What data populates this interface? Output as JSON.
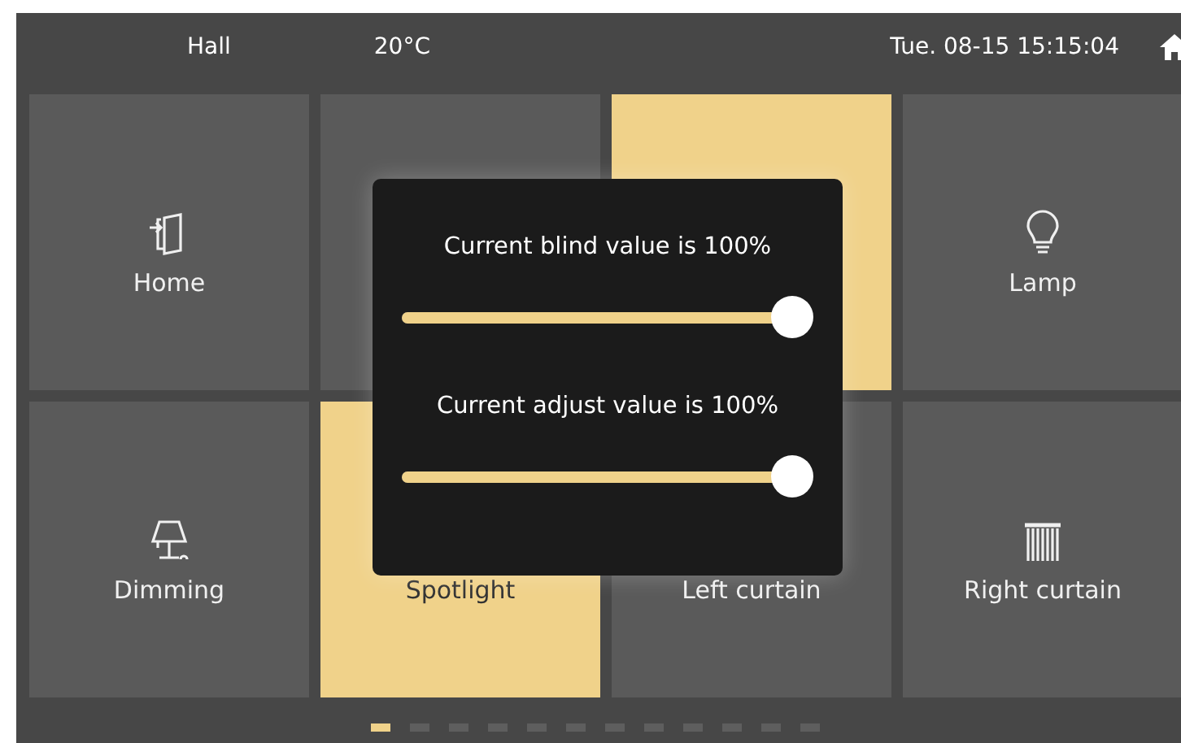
{
  "header": {
    "room": "Hall",
    "temperature": "20°C",
    "datetime": "Tue. 08-15 15:15:04"
  },
  "tiles": [
    {
      "label": "Home",
      "on": false
    },
    {
      "on": false
    },
    {
      "on": true
    },
    {
      "label": "Lamp",
      "on": false
    },
    {
      "label": "Dimming",
      "on": false
    },
    {
      "label": "Spotlight",
      "on": true
    },
    {
      "label": "Left curtain",
      "on": false
    },
    {
      "label": "Right curtain",
      "on": false
    }
  ],
  "dialog": {
    "sliders": [
      {
        "label": "Current blind value is 100%",
        "level": 1.0
      },
      {
        "label": "Current adjust value is 100%",
        "level": 1.0
      }
    ]
  },
  "pager": [
    {
      "selected": true
    },
    {
      "selected": false
    },
    {
      "selected": false
    },
    {
      "selected": false
    },
    {
      "selected": false
    },
    {
      "selected": false
    },
    {
      "selected": false
    },
    {
      "selected": false
    },
    {
      "selected": false
    },
    {
      "selected": false
    },
    {
      "selected": false
    },
    {
      "selected": false
    }
  ]
}
